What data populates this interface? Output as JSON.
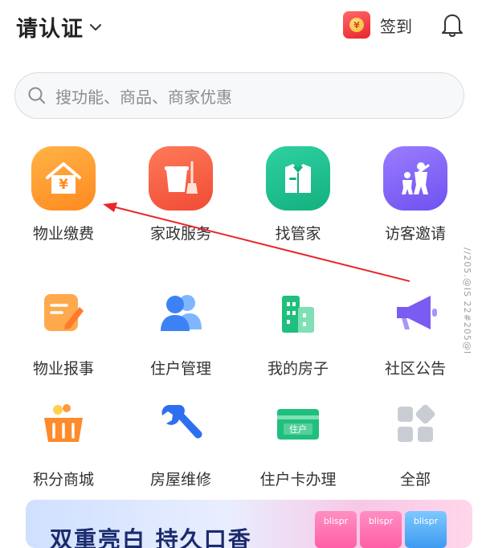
{
  "header": {
    "title": "请认证",
    "signin_label": "签到",
    "signin_coin": "¥"
  },
  "search": {
    "placeholder": "搜功能、商品、商家优惠"
  },
  "grid": {
    "items": [
      {
        "label": "物业缴费",
        "icon": "house-yen-icon"
      },
      {
        "label": "家政服务",
        "icon": "bucket-broom-icon"
      },
      {
        "label": "找管家",
        "icon": "butler-icon"
      },
      {
        "label": "访客邀请",
        "icon": "visitors-icon"
      },
      {
        "label": "物业报事",
        "icon": "report-note-icon"
      },
      {
        "label": "住户管理",
        "icon": "residents-icon"
      },
      {
        "label": "我的房子",
        "icon": "buildings-icon"
      },
      {
        "label": "社区公告",
        "icon": "megaphone-icon"
      },
      {
        "label": "积分商城",
        "icon": "shopping-basket-icon"
      },
      {
        "label": "房屋维修",
        "icon": "wrench-icon"
      },
      {
        "label": "住户卡办理",
        "icon": "resident-card-icon"
      },
      {
        "label": "全部",
        "icon": "all-grid-icon"
      }
    ],
    "card_text": "住户"
  },
  "banner": {
    "text": "双重亮白 持久口香",
    "product_text": "blispr"
  },
  "watermark": "//205.@IS 22#205@I"
}
